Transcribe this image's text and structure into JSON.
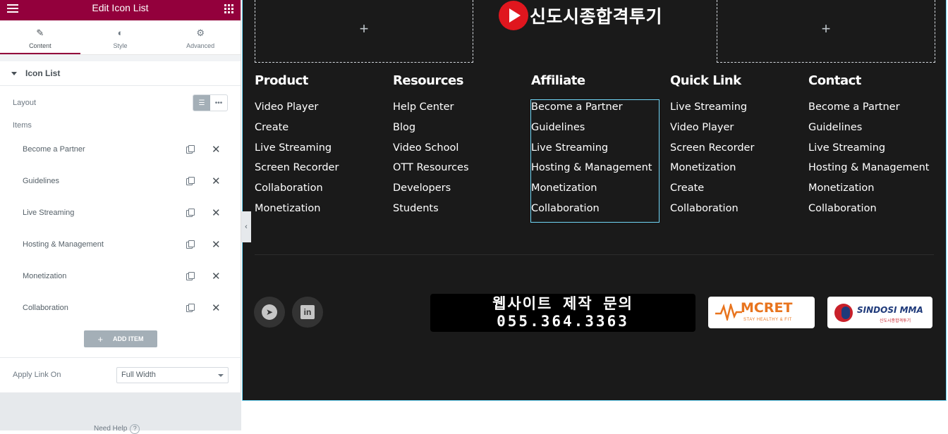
{
  "panel": {
    "title": "Edit Icon List",
    "tabs": [
      {
        "label": "Content",
        "icon": "pencil-icon"
      },
      {
        "label": "Style",
        "icon": "half-circle-icon"
      },
      {
        "label": "Advanced",
        "icon": "gear-icon"
      }
    ],
    "section_title": "Icon List",
    "layout_label": "Layout",
    "items_label": "Items",
    "items": [
      {
        "label": "Become a Partner"
      },
      {
        "label": "Guidelines"
      },
      {
        "label": "Live Streaming"
      },
      {
        "label": "Hosting & Management"
      },
      {
        "label": "Monetization"
      },
      {
        "label": "Collaboration"
      }
    ],
    "add_item_label": "ADD ITEM",
    "apply_link_label": "Apply Link On",
    "apply_link_value": "Full Width",
    "need_help_label": "Need Help"
  },
  "preview": {
    "brand_text": "신도시종합격투기",
    "columns": [
      {
        "id": "product",
        "title": "Product",
        "links": [
          "Video Player",
          "Create",
          "Live Streaming",
          "Screen Recorder",
          "Collaboration",
          "Monetization"
        ]
      },
      {
        "id": "resources",
        "title": "Resources",
        "links": [
          "Help Center",
          "Blog",
          "Video School",
          "OTT Resources",
          "Developers",
          "Students"
        ]
      },
      {
        "id": "affiliate",
        "title": "Affiliate",
        "links": [
          "Become a Partner",
          "Guidelines",
          "Live Streaming",
          "Hosting & Management",
          "Monetization",
          "Collaboration"
        ]
      },
      {
        "id": "quicklink",
        "title": "Quick Link",
        "links": [
          "Live Streaming",
          "Video Player",
          "Screen Recorder",
          "Monetization",
          "Create",
          "Collaboration"
        ]
      },
      {
        "id": "contact",
        "title": "Contact",
        "links": [
          "Become a Partner",
          "Guidelines",
          "Live Streaming",
          "Hosting & Management",
          "Monetization",
          "Collaboration"
        ]
      }
    ],
    "contact_box": {
      "line1": "웹사이트 제작 문의",
      "line2": "055.364.3363"
    },
    "sponsors": [
      {
        "name": "MCRET",
        "tagline": "STAY HEALTHY & FIT"
      },
      {
        "name": "SINDOSI MMA",
        "tagline": "신도시종합격투기"
      }
    ]
  },
  "colors": {
    "accent": "#93003c",
    "footer_bg": "#1a1a1a",
    "selection": "#71d7f7"
  }
}
